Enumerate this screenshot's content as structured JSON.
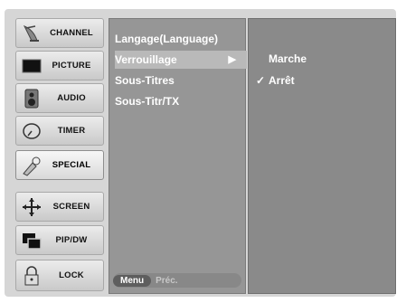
{
  "left_menu": [
    {
      "label": "CHANNEL",
      "icon": "satellite-dish-icon"
    },
    {
      "label": "PICTURE",
      "icon": "tv-screen-icon"
    },
    {
      "label": "AUDIO",
      "icon": "speaker-icon"
    },
    {
      "label": "TIMER",
      "icon": "clock-icon"
    },
    {
      "label": "SPECIAL",
      "icon": "special-icon",
      "selected": true
    },
    {
      "label": "SCREEN",
      "icon": "screen-arrows-icon"
    },
    {
      "label": "PIP/DW",
      "icon": "pip-icon"
    },
    {
      "label": "LOCK",
      "icon": "lock-icon"
    }
  ],
  "submenu": {
    "items": [
      {
        "label": "Langage(Language)"
      },
      {
        "label": "Verrouillage",
        "selected": true,
        "arrow": "▶"
      },
      {
        "label": "Sous-Titres"
      },
      {
        "label": "Sous-Titr/TX"
      }
    ],
    "menu_button": "Menu",
    "back_label": "Préc."
  },
  "options": {
    "items": [
      {
        "label": "Marche",
        "checked": false
      },
      {
        "label": "Arrêt",
        "checked": true
      }
    ],
    "check_glyph": "✓"
  },
  "colors": {
    "panel_mid": "#969696",
    "panel_right": "#8a8a8a",
    "highlight": "#b9b9b9"
  }
}
